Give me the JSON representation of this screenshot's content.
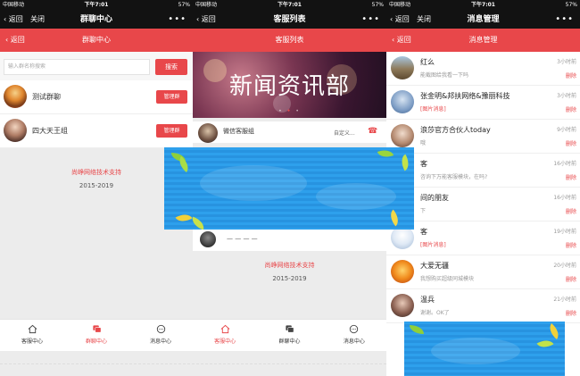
{
  "status": {
    "carrier": "中国移动",
    "time": "下午7:01",
    "battery": "57%"
  },
  "panel1": {
    "back": "返回",
    "close": "关闭",
    "title": "群聊中心",
    "more": "•••",
    "subheader_back": "返回",
    "subheader_title": "群聊中心",
    "search_placeholder": "输入群名称搜索",
    "search_button": "搜索",
    "groups": [
      {
        "name": "测试群聊",
        "button": "管理群"
      },
      {
        "name": "四大天王组",
        "button": "管理群"
      }
    ],
    "support": "尚峥网络技术支持",
    "years": "2015-2019"
  },
  "panel2": {
    "back": "返回",
    "title": "客服列表",
    "more": "•••",
    "subheader_title": "客服列表",
    "banner_title": "新闻资讯部",
    "service_name": "微信客服组",
    "service_mode": "自定义...",
    "service_name2": "— — — —",
    "support": "尚峥网络技术支持",
    "years": "2015-2019"
  },
  "panel3": {
    "back": "返回",
    "close": "关闭",
    "title": "消息管理",
    "more": "•••",
    "subheader_back": "返回",
    "subheader_title": "消息管理",
    "delete_label": "删除",
    "messages": [
      {
        "name": "红么",
        "text": "能截图给我看一下吗",
        "time": "3小时前",
        "is_image": false
      },
      {
        "name": "张金明&邦扶网络&豫丽科技",
        "text": "[图片消息]",
        "time": "3小时前",
        "is_image": true
      },
      {
        "name": "浪莎官方合伙人today",
        "text": "哦",
        "time": "9小时前",
        "is_image": false
      },
      {
        "name": "客",
        "text": "咨询下万能客服模块，在吗?",
        "time": "16小时前",
        "is_image": false
      },
      {
        "name": "间的朋友",
        "text": "下",
        "time": "16小时前",
        "is_image": false
      },
      {
        "name": "客",
        "text": "[图片消息]",
        "time": "19小时前",
        "is_image": true
      },
      {
        "name": "大爱无疆",
        "text": "我想购买超级同城模块",
        "time": "20小时前",
        "is_image": false
      },
      {
        "name": "温兵",
        "text": "谢谢。OK了",
        "time": "21小时前",
        "is_image": false
      }
    ]
  },
  "tabs": {
    "service": "客服中心",
    "group": "群聊中心",
    "message": "消息中心"
  },
  "colors": {
    "accent": "#e8474a",
    "dark": "#121212",
    "popup": "#2f9be8"
  }
}
